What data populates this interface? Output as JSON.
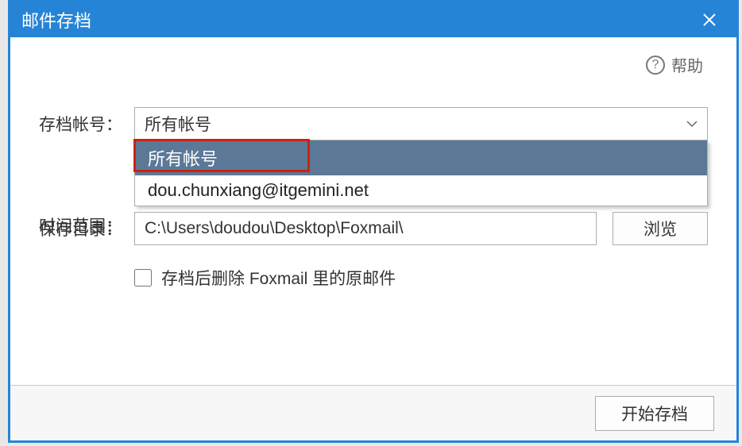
{
  "dialog": {
    "title": "邮件存档"
  },
  "help": {
    "label": "帮助"
  },
  "account": {
    "label": "存档帐号：",
    "selected": "所有帐号",
    "options": [
      "所有帐号",
      "dou.chunxiang@itgemini.net"
    ]
  },
  "time_range": {
    "label": "时间范围："
  },
  "save_dir": {
    "label": "保存目录：",
    "path": "C:\\Users\\doudou\\Desktop\\Foxmail\\",
    "browse_label": "浏览"
  },
  "delete_after": {
    "label": "存档后删除 Foxmail 里的原邮件",
    "checked": false
  },
  "footer": {
    "start_label": "开始存档"
  }
}
